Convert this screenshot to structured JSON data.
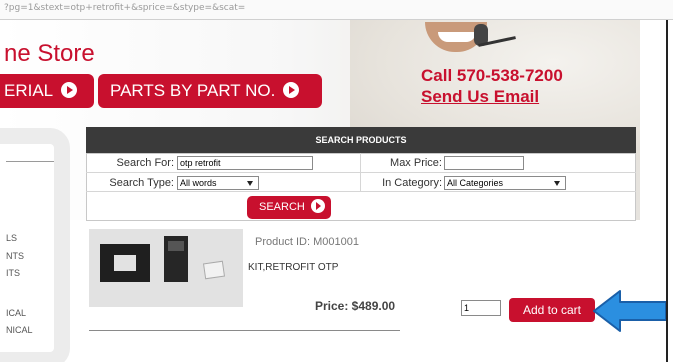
{
  "browser": {
    "url": "?pg=1&stext=otp+retrofit+&sprice=&stype=&scat="
  },
  "header": {
    "store_title": "ne Store",
    "nav": {
      "serial_label": "ERIAL",
      "parts_label": "PARTS BY PART NO."
    },
    "contact": {
      "phone": "Call 570-538-7200",
      "email": "Send Us Email"
    }
  },
  "sidebar": {
    "items": [
      "LS",
      "NTS",
      "ITS",
      "ICAL",
      "NICAL"
    ]
  },
  "search": {
    "title": "SEARCH PRODUCTS",
    "search_for_label": "Search For:",
    "search_for_value": "otp retrofit",
    "max_price_label": "Max Price:",
    "max_price_value": "",
    "search_type_label": "Search Type:",
    "search_type_value": "All words",
    "category_label": "In Category:",
    "category_value": "All Categories",
    "button_label": "SEARCH"
  },
  "product": {
    "id_text": "Product ID: M001001",
    "name": "KIT,RETROFIT OTP",
    "price_text": "Price: $489.00",
    "quantity": "1",
    "add_to_cart_label": "Add to cart"
  },
  "colors": {
    "brand_red": "#c8102e",
    "header_dark": "#3a3a3a",
    "pointer_blue": "#2b8fe0"
  },
  "icons": {
    "nav_arrow": "circle-arrow-right-icon",
    "search_arrow": "circle-arrow-right-icon",
    "pointer": "arrow-left-icon"
  }
}
